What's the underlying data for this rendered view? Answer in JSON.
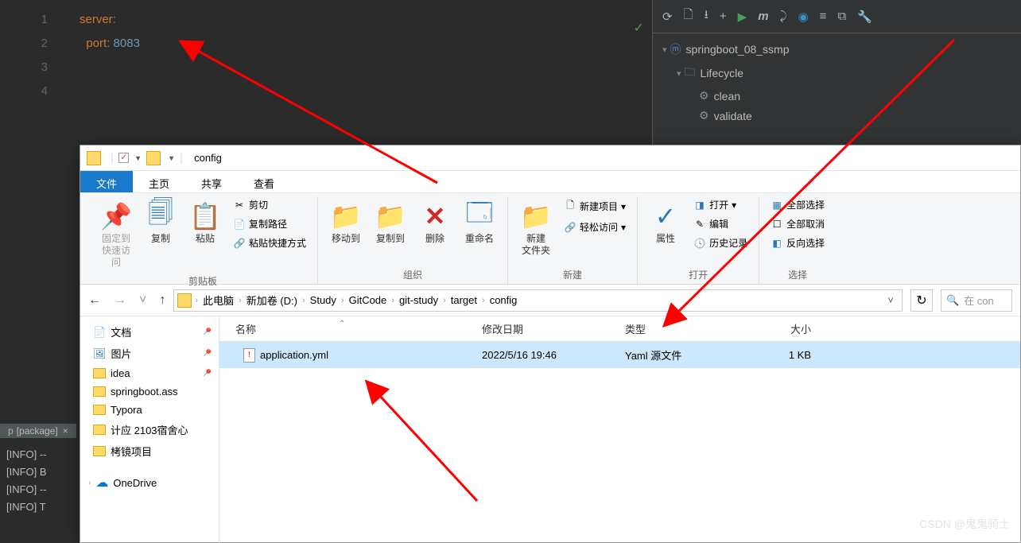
{
  "editor": {
    "lines": [
      "1",
      "2",
      "3",
      "4"
    ],
    "code": {
      "line1_key": "server",
      "line2_key": "port",
      "line2_value": "8083"
    }
  },
  "maven": {
    "project": "springboot_08_ssmp",
    "lifecycle": "Lifecycle",
    "goals": [
      "clean",
      "validate"
    ]
  },
  "terminal": {
    "tab": "[package]",
    "lines": [
      "[INFO] --",
      "[INFO] B",
      "[INFO] --",
      "[INFO] T"
    ]
  },
  "explorer": {
    "title": "config",
    "tabs": {
      "file": "文件",
      "home": "主页",
      "share": "共享",
      "view": "查看"
    },
    "ribbon": {
      "pin": {
        "label1": "固定到",
        "label2": "快速访问"
      },
      "copy": "复制",
      "paste": "粘贴",
      "cut": "剪切",
      "copypath": "复制路径",
      "pasteshortcut": "粘贴快捷方式",
      "clipboard_group": "剪贴板",
      "moveto": "移动到",
      "copyto": "复制到",
      "delete": "删除",
      "rename": "重命名",
      "organize_group": "组织",
      "newfolder": {
        "l1": "新建",
        "l2": "文件夹"
      },
      "newitem": "新建项目",
      "easyaccess": "轻松访问",
      "new_group": "新建",
      "properties": "属性",
      "open": "打开",
      "edit": "编辑",
      "history": "历史记录",
      "open_group": "打开",
      "selectall": "全部选择",
      "deselectall": "全部取消",
      "invertsel": "反向选择",
      "select_group": "选择"
    },
    "breadcrumb": [
      "此电脑",
      "新加卷 (D:)",
      "Study",
      "GitCode",
      "git-study",
      "target",
      "config"
    ],
    "search_placeholder": "在 con",
    "sidebar": {
      "documents": "文档",
      "pictures": "图片",
      "idea": "idea",
      "springboot": "springboot.ass",
      "typora": "Typora",
      "room": "计应 2103宿舍心",
      "project": "栲镜项目",
      "onedrive": "OneDrive"
    },
    "columns": {
      "name": "名称",
      "date": "修改日期",
      "type": "类型",
      "size": "大小"
    },
    "file": {
      "name": "application.yml",
      "date": "2022/5/16 19:46",
      "type": "Yaml 源文件",
      "size": "1 KB"
    }
  },
  "watermark": "CSDN @鬼鬼骑士"
}
